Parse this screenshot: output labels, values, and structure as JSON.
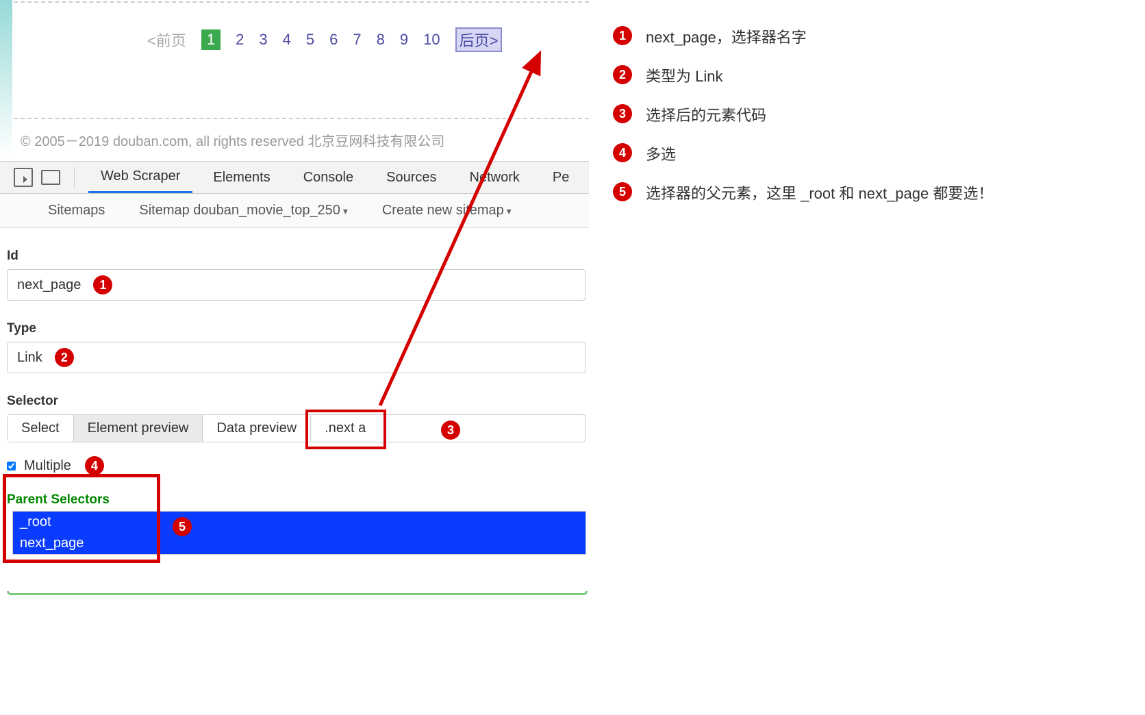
{
  "pagination": {
    "prev": "<前页",
    "pages": [
      "1",
      "2",
      "3",
      "4",
      "5",
      "6",
      "7",
      "8",
      "9",
      "10"
    ],
    "next": "后页>"
  },
  "copyright": "© 2005－2019 douban.com, all rights reserved 北京豆网科技有限公司",
  "devtools": {
    "tabs": {
      "webscraper": "Web Scraper",
      "elements": "Elements",
      "console": "Console",
      "sources": "Sources",
      "network": "Network",
      "more": "Pe"
    },
    "subbar": {
      "sitemaps": "Sitemaps",
      "sitemap": "Sitemap douban_movie_top_250",
      "create": "Create new sitemap"
    }
  },
  "form": {
    "id_label": "Id",
    "id_value": "next_page",
    "type_label": "Type",
    "type_value": "Link",
    "selector_label": "Selector",
    "select_btn": "Select",
    "element_preview": "Element preview",
    "data_preview": "Data preview",
    "selector_value": ".next a",
    "multiple_label": "Multiple",
    "parent_label": "Parent Selectors",
    "parent_items": [
      "_root",
      "next_page"
    ]
  },
  "legend": {
    "n1": "1",
    "t1": "next_page，选择器名字",
    "n2": "2",
    "t2": "类型为 Link",
    "n3": "3",
    "t3": "选择后的元素代码",
    "n4": "4",
    "t4": "多选",
    "n5": "5",
    "t5": "选择器的父元素，这里 _root 和 next_page 都要选！"
  },
  "badges": {
    "b1": "1",
    "b2": "2",
    "b3": "3",
    "b4": "4",
    "b5": "5"
  }
}
